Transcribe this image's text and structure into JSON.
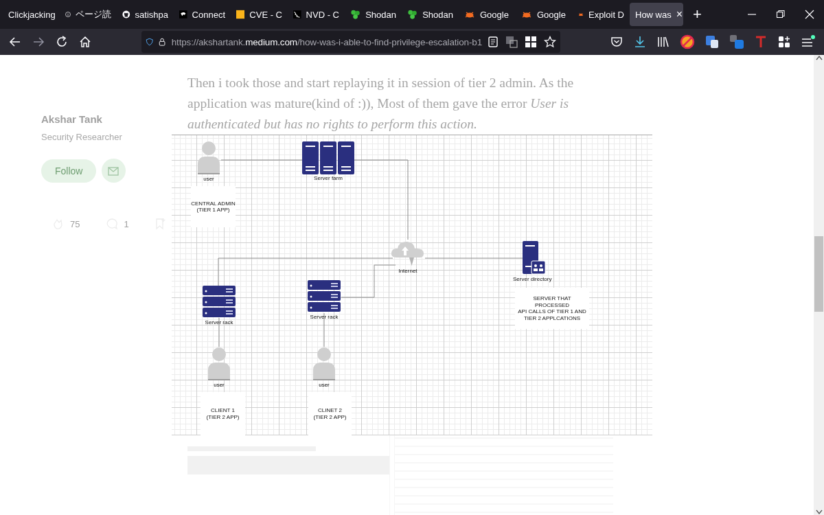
{
  "tabs": [
    {
      "label": "Clickjacking",
      "selected": false
    },
    {
      "label": "ページ読",
      "selected": false
    },
    {
      "label": "satishpa",
      "selected": false
    },
    {
      "label": "Connect",
      "selected": false
    },
    {
      "label": "CVE - C",
      "selected": false
    },
    {
      "label": "NVD - C",
      "selected": false
    },
    {
      "label": "Shodan",
      "selected": false
    },
    {
      "label": "Shodan",
      "selected": false
    },
    {
      "label": "Google",
      "selected": false
    },
    {
      "label": "Google",
      "selected": false
    },
    {
      "label": "Exploit D",
      "selected": false
    },
    {
      "label": "How was",
      "selected": true,
      "close": "×"
    }
  ],
  "new_tab": "+",
  "url": {
    "prefix": "https://akshartank.",
    "domain": "medium.com",
    "path": "/how-was-i-able-to-find-privilege-escalation-b1"
  },
  "sidebar": {
    "author": "Akshar Tank",
    "bio": "Security Researcher",
    "follow": "Follow",
    "claps": "75",
    "responses": "1"
  },
  "article": {
    "paragraph": "Then i took those and start replaying it in session of tier 2 admin. As the application was mature(kind of :)), Most of them gave the error *User is authenticated but has no rights to perform this action.*"
  },
  "diagram": {
    "nodes": [
      {
        "kind": "person",
        "label": "user"
      },
      {
        "kind": "note",
        "text": "CENTRAL ADMIN\n(TIER 1 APP)"
      },
      {
        "kind": "server_farm",
        "label": "Server farm"
      },
      {
        "kind": "cloud",
        "label": "Internet"
      },
      {
        "kind": "server_directory",
        "label": "Server directory"
      },
      {
        "kind": "note",
        "text": "SERVER THAT\nPROCESSED\nAPI CALLS OF TIER 1 AND\nTIER 2 APPLCATIONS"
      },
      {
        "kind": "server_rack",
        "label": "Server rack"
      },
      {
        "kind": "server_rack",
        "label": "Server rack"
      },
      {
        "kind": "person",
        "label": "user"
      },
      {
        "kind": "person",
        "label": "user"
      },
      {
        "kind": "note",
        "text": "CLIENT 1\n(TIER 2 APP)"
      },
      {
        "kind": "note",
        "text": "CLINET 2\n(TIER 2 APP)"
      }
    ]
  }
}
